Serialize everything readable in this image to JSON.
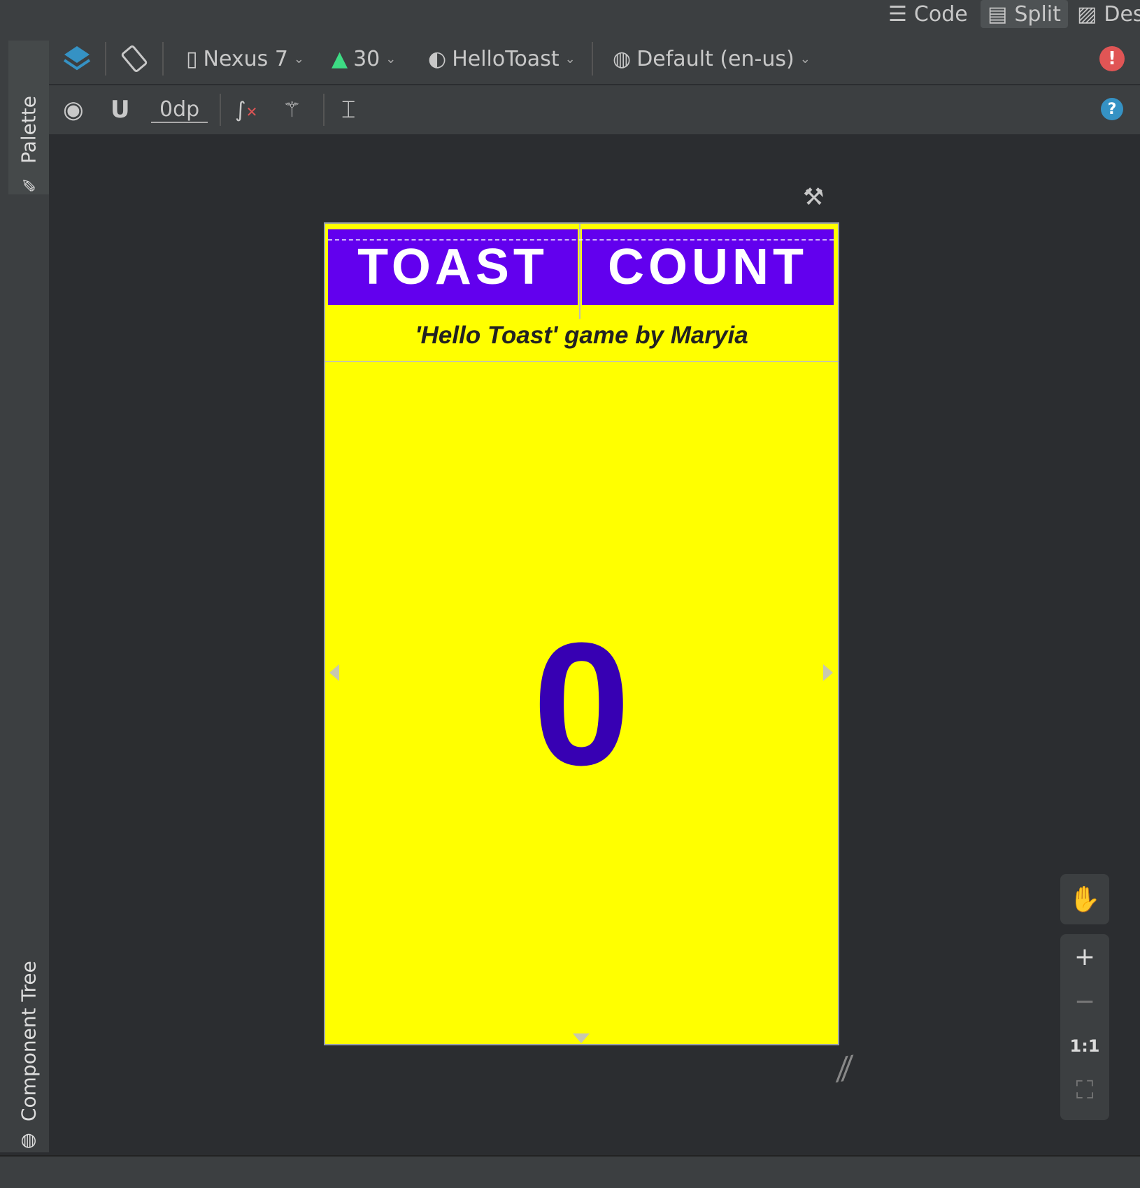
{
  "view_modes": {
    "code": "Code",
    "split": "Split",
    "design": "Des"
  },
  "side_tabs": {
    "palette": "Palette",
    "component_tree": "Component Tree"
  },
  "toolbar": {
    "device": "Nexus 7",
    "api_level": "30",
    "theme": "HelloToast",
    "locale": "Default (en-us)",
    "margin": "0dp"
  },
  "app": {
    "toast_button": "TOAST",
    "count_button": "COUNT",
    "title": "'Hello Toast' game by Maryia",
    "count_value": "0"
  },
  "zoom": {
    "zoom_in": "+",
    "zoom_out": "−",
    "actual_size": "1:1"
  },
  "colors": {
    "primary": "#6200ee",
    "background": "#ffff00",
    "count_text": "#3700b3",
    "error": "#e05555",
    "help": "#3592c4"
  }
}
